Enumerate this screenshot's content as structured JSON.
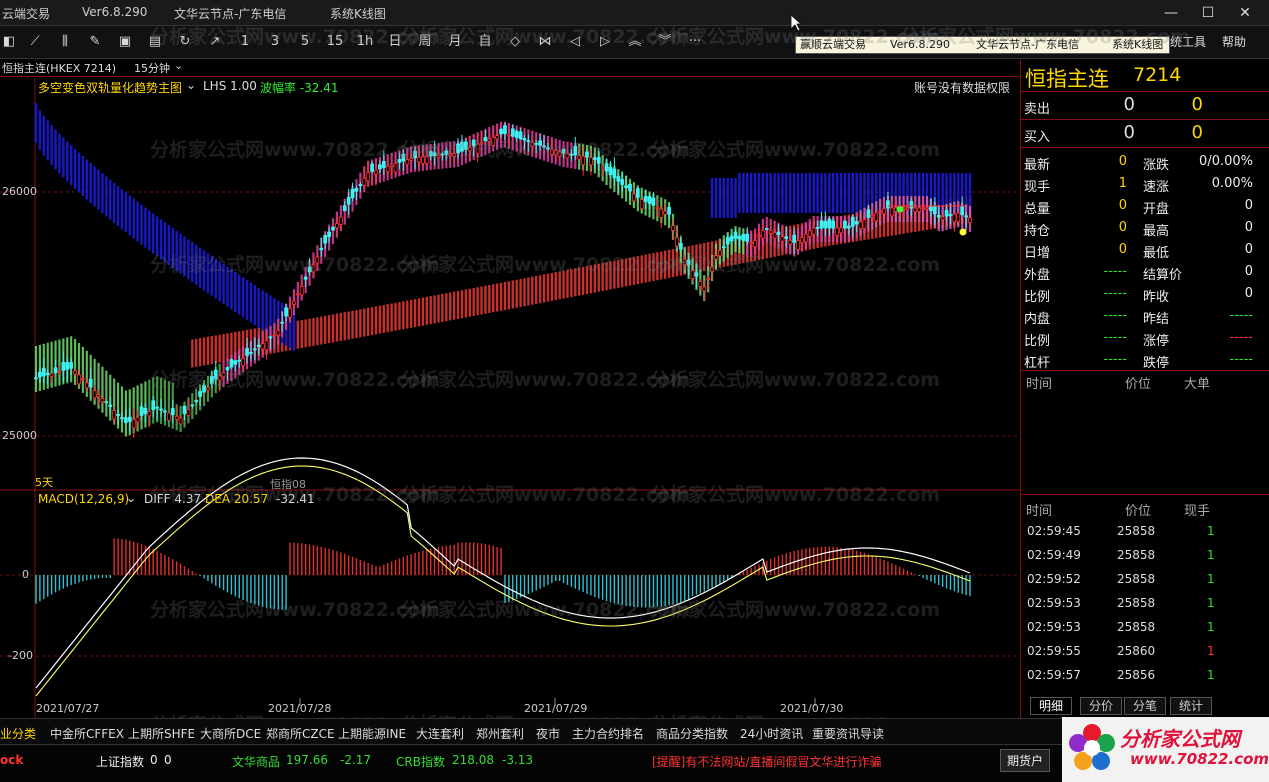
{
  "window": {
    "title": "云端交易",
    "version": "Ver6.8.290",
    "node": "文华云节点-广东电信",
    "system": "系统K线图",
    "min": "—",
    "max": "☐",
    "close": "✕"
  },
  "toolbar": {
    "periods": [
      "1",
      "3",
      "5",
      "15",
      "1h",
      "日",
      "周",
      "月",
      "自"
    ],
    "more": "···",
    "tools_label": "统工具",
    "help_label": "帮助"
  },
  "tooltip": {
    "title": "赢顺云端交易",
    "version": "Ver6.8.290",
    "node": "文华云节点-广东电信",
    "system": "系统K线图"
  },
  "subbar": {
    "symbol": "恒指主连(HKEX 7214)",
    "period": "15分钟"
  },
  "main_indicator": {
    "name": "多空变色双轨量化趋势主图",
    "lhs": "LHS 1.00",
    "wave": "波幅率 -32.41",
    "notice": "账号没有数据权限",
    "y_labels": [
      "26000",
      "25000"
    ],
    "five_day": "5天",
    "series_label": "恒指08"
  },
  "macd": {
    "name": "MACD(12,26,9)",
    "diff": "DIFF 4.37",
    "dea": "DEA 20.57",
    "macd_val": "-32.41",
    "y_labels": [
      "0",
      "-200"
    ]
  },
  "dates": [
    "2021/07/27",
    "2021/07/28",
    "2021/07/29",
    "2021/07/30"
  ],
  "right": {
    "name": "恒指主连",
    "code": "7214",
    "sell": {
      "label": "卖出",
      "price": "0",
      "vol": "0"
    },
    "buy": {
      "label": "买入",
      "price": "0",
      "vol": "0"
    },
    "stats": [
      {
        "l": "最新",
        "v": "0",
        "l2": "涨跌",
        "v2": "0/0.00%"
      },
      {
        "l": "现手",
        "v": "1",
        "l2": "速涨",
        "v2": "0.00%"
      },
      {
        "l": "总量",
        "v": "0",
        "l2": "开盘",
        "v2": "0"
      },
      {
        "l": "持仓",
        "v": "0",
        "l2": "最高",
        "v2": "0"
      },
      {
        "l": "日增",
        "v": "0",
        "l2": "最低",
        "v2": "0"
      },
      {
        "l": "外盘",
        "v": "-----",
        "l2": "结算价",
        "v2": "0"
      },
      {
        "l": "比例",
        "v": "-----",
        "l2": "昨收",
        "v2": "0"
      },
      {
        "l": "内盘",
        "v": "-----",
        "l2": "昨结",
        "v2": "-----"
      },
      {
        "l": "比例",
        "v": "-----",
        "l2": "涨停",
        "v2": "-----"
      },
      {
        "l": "杠杆",
        "v": "-----",
        "l2": "跌停",
        "v2": "-----"
      }
    ],
    "big_header": {
      "time": "时间",
      "price": "价位",
      "big": "大单"
    },
    "tick_header": {
      "time": "时间",
      "price": "价位",
      "vol": "现手"
    },
    "ticks": [
      {
        "t": "02:59:45",
        "p": "25858",
        "v": "1",
        "c": "#33dd33"
      },
      {
        "t": "02:59:49",
        "p": "25858",
        "v": "1",
        "c": "#33dd33"
      },
      {
        "t": "02:59:52",
        "p": "25858",
        "v": "1",
        "c": "#33dd33"
      },
      {
        "t": "02:59:53",
        "p": "25858",
        "v": "1",
        "c": "#33dd33"
      },
      {
        "t": "02:59:53",
        "p": "25858",
        "v": "1",
        "c": "#33dd33"
      },
      {
        "t": "02:59:55",
        "p": "25860",
        "v": "1",
        "c": "#ff3333"
      },
      {
        "t": "02:59:57",
        "p": "25856",
        "v": "1",
        "c": "#33dd33"
      }
    ],
    "tabs": [
      "明细",
      "分价",
      "分笔",
      "统计"
    ]
  },
  "bottom": {
    "items": [
      "业分类",
      "中金所CFFEX",
      "上期所SHFE",
      "大商所DCE",
      "郑商所CZCE",
      "上期能源INE",
      "大连套利",
      "郑州套利",
      "夜市",
      "主力合约排名",
      "商品分类指数",
      "24小时资讯",
      "重要资讯导读"
    ]
  },
  "status": {
    "left": "ock",
    "sh_label": "上证指数",
    "sh_v1": "0",
    "sh_v2": "0",
    "wh_label": "文华商品",
    "wh_val": "197.66",
    "wh_chg": "-2.17",
    "crb_label": "CRB指数",
    "crb_val": "218.08",
    "crb_chg": "-3.13",
    "warn": "[提醒]有不法网站/直播间假冒文华进行诈骗",
    "account": "期货户"
  },
  "logo": {
    "main": "分析家公式网",
    "url": "www.70822.com"
  },
  "watermark": "分析家公式网www.70822.com",
  "colors": {
    "up": "#ff3333",
    "down": "#44ffff",
    "accent": "#ffd700",
    "frame": "#8a1010"
  }
}
